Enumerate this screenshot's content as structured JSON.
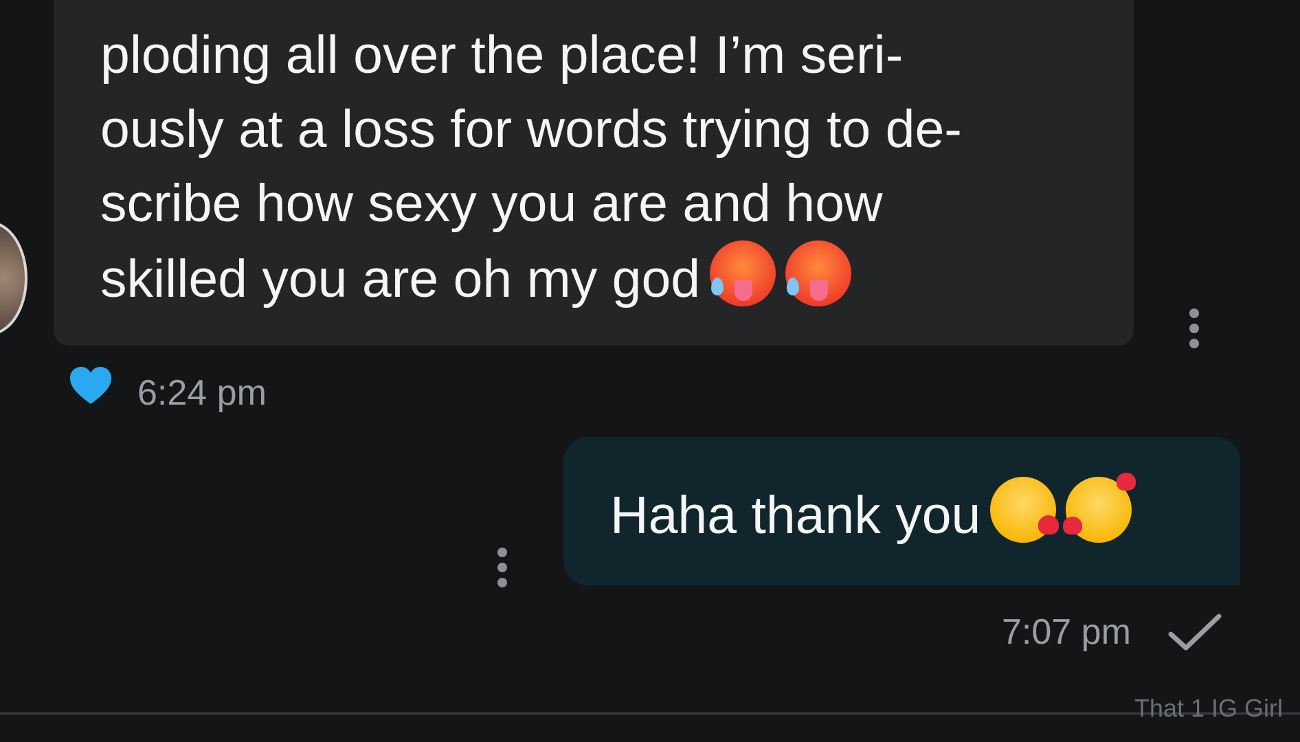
{
  "incoming_message": {
    "text": "ploding all over the place! I’m seri-\nously at a loss for words trying to de-\nscribe how sexy you are and how\nskilled you are oh my god",
    "emojis": [
      "hot-face-emoji",
      "hot-face-emoji"
    ],
    "reaction": "heart",
    "reaction_color": "#29a9f0",
    "time": "6:24 pm",
    "bubble_color": "#232527"
  },
  "outgoing_message": {
    "text": "Haha thank you",
    "emojis": [
      "kissing-face-emoji",
      "smiling-face-with-hearts-emoji"
    ],
    "time": "7:07 pm",
    "status": "sent-check",
    "bubble_color": "#10262c"
  },
  "watermark": "That 1 IG Girl",
  "colors": {
    "background": "#141517",
    "text": "#f4f5f6",
    "muted": "#9a9da2"
  }
}
